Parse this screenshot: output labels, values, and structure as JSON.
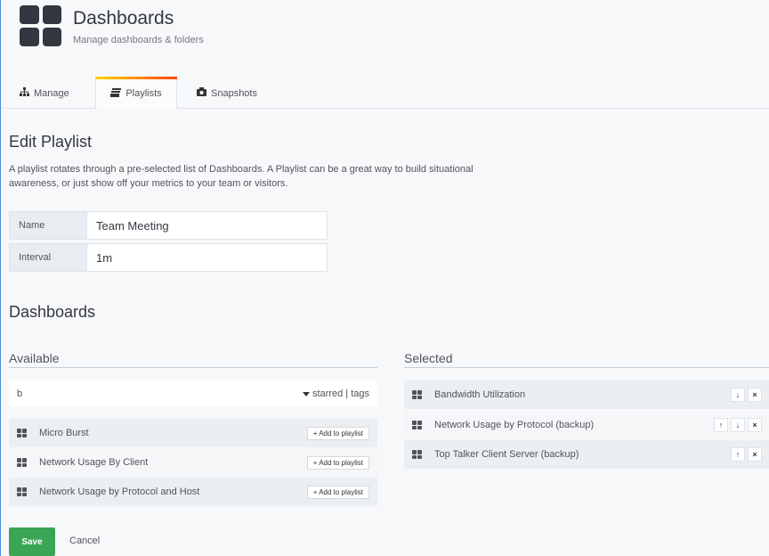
{
  "header": {
    "title": "Dashboards",
    "subtitle": "Manage dashboards & folders"
  },
  "tabs": [
    {
      "label": "Manage",
      "icon": "sitemap-icon",
      "active": false
    },
    {
      "label": "Playlists",
      "icon": "playlist-icon",
      "active": true
    },
    {
      "label": "Snapshots",
      "icon": "camera-icon",
      "active": false
    }
  ],
  "edit": {
    "title": "Edit Playlist",
    "description": "A playlist rotates through a pre-selected list of Dashboards. A Playlist can be a great way to build situational awareness, or just show off your metrics to your team or visitors.",
    "name_label": "Name",
    "name_value": "Team Meeting",
    "interval_label": "Interval",
    "interval_value": "1m"
  },
  "dashboards": {
    "title": "Dashboards",
    "available_title": "Available",
    "selected_title": "Selected",
    "search_value": "b",
    "filter_label": "starred | tags",
    "add_label": "+ Add to playlist",
    "available": [
      {
        "label": "Micro Burst"
      },
      {
        "label": "Network Usage By Client"
      },
      {
        "label": "Network Usage by Protocol and Host"
      }
    ],
    "selected": [
      {
        "label": "Bandwidth Utilization"
      },
      {
        "label": "Network Usage by Protocol (backup)"
      },
      {
        "label": "Top Talker Client Server (backup)"
      }
    ]
  },
  "actions": {
    "save_label": "Save",
    "cancel_label": "Cancel"
  },
  "colors": {
    "save_green": "#3aa655",
    "tab_accent_start": "#ffd500",
    "tab_accent_end": "#ff4400"
  }
}
